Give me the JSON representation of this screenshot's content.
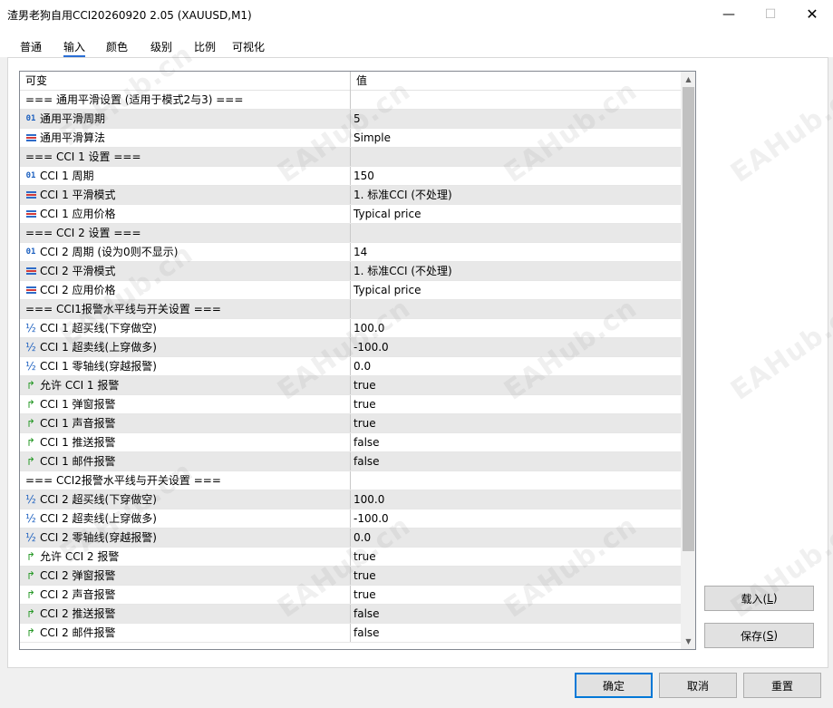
{
  "window": {
    "title": "渣男老狗自用CCI20260920 2.05 (XAUUSD,M1)",
    "minimize_glyph": "—",
    "maximize_glyph": "☐",
    "close_glyph": "✕"
  },
  "tabs": [
    {
      "label": "普通",
      "active": false
    },
    {
      "label": "输入",
      "active": true
    },
    {
      "label": "颜色",
      "active": false
    },
    {
      "label": "级别",
      "active": false
    },
    {
      "label": "比例",
      "active": false
    },
    {
      "label": "可视化",
      "active": false
    }
  ],
  "grid": {
    "col_variable": "可变",
    "col_value": "值",
    "rows": [
      {
        "type": "group",
        "name": "=== 通用平滑设置 (适用于模式2与3) ===",
        "value": ""
      },
      {
        "type": "int",
        "name": "通用平滑周期",
        "value": "5"
      },
      {
        "type": "enum",
        "name": "通用平滑算法",
        "value": "Simple"
      },
      {
        "type": "group",
        "name": "=== CCI 1 设置 ===",
        "value": ""
      },
      {
        "type": "int",
        "name": "CCI 1 周期",
        "value": "150"
      },
      {
        "type": "enum",
        "name": "CCI 1 平滑模式",
        "value": "1. 标准CCI (不处理)"
      },
      {
        "type": "enum",
        "name": "CCI 1 应用价格",
        "value": "Typical price"
      },
      {
        "type": "group",
        "name": "=== CCI 2 设置 ===",
        "value": ""
      },
      {
        "type": "int",
        "name": "CCI 2 周期 (设为0则不显示)",
        "value": "14"
      },
      {
        "type": "enum",
        "name": "CCI 2 平滑模式",
        "value": "1. 标准CCI (不处理)"
      },
      {
        "type": "enum",
        "name": "CCI 2 应用价格",
        "value": "Typical price"
      },
      {
        "type": "group",
        "name": "=== CCI1报警水平线与开关设置 ===",
        "value": ""
      },
      {
        "type": "double",
        "name": "CCI 1 超买线(下穿做空)",
        "value": "100.0"
      },
      {
        "type": "double",
        "name": "CCI 1 超卖线(上穿做多)",
        "value": "-100.0"
      },
      {
        "type": "double",
        "name": "CCI 1 零轴线(穿越报警)",
        "value": "0.0"
      },
      {
        "type": "bool",
        "name": "允许 CCI 1 报警",
        "value": "true"
      },
      {
        "type": "bool",
        "name": "CCI 1 弹窗报警",
        "value": "true"
      },
      {
        "type": "bool",
        "name": "CCI 1 声音报警",
        "value": "true"
      },
      {
        "type": "bool",
        "name": "CCI 1 推送报警",
        "value": "false"
      },
      {
        "type": "bool",
        "name": "CCI 1 邮件报警",
        "value": "false"
      },
      {
        "type": "group",
        "name": "=== CCI2报警水平线与开关设置 ===",
        "value": ""
      },
      {
        "type": "double",
        "name": "CCI 2 超买线(下穿做空)",
        "value": "100.0"
      },
      {
        "type": "double",
        "name": "CCI 2 超卖线(上穿做多)",
        "value": "-100.0"
      },
      {
        "type": "double",
        "name": "CCI 2 零轴线(穿越报警)",
        "value": "0.0"
      },
      {
        "type": "bool",
        "name": "允许 CCI 2 报警",
        "value": "true"
      },
      {
        "type": "bool",
        "name": "CCI 2 弹窗报警",
        "value": "true"
      },
      {
        "type": "bool",
        "name": "CCI 2 声音报警",
        "value": "true"
      },
      {
        "type": "bool",
        "name": "CCI 2 推送报警",
        "value": "false"
      },
      {
        "type": "bool",
        "name": "CCI 2 邮件报警",
        "value": "false"
      }
    ]
  },
  "side_buttons": {
    "load_label": "载入(",
    "load_key": "L",
    "load_tail": ")",
    "save_label": "保存(",
    "save_key": "S",
    "save_tail": ")"
  },
  "footer": {
    "ok": "确定",
    "cancel": "取消",
    "reset": "重置"
  },
  "watermark": "EAHub.cn",
  "icons": {
    "int": "01",
    "double": "½",
    "bool": "↱"
  }
}
